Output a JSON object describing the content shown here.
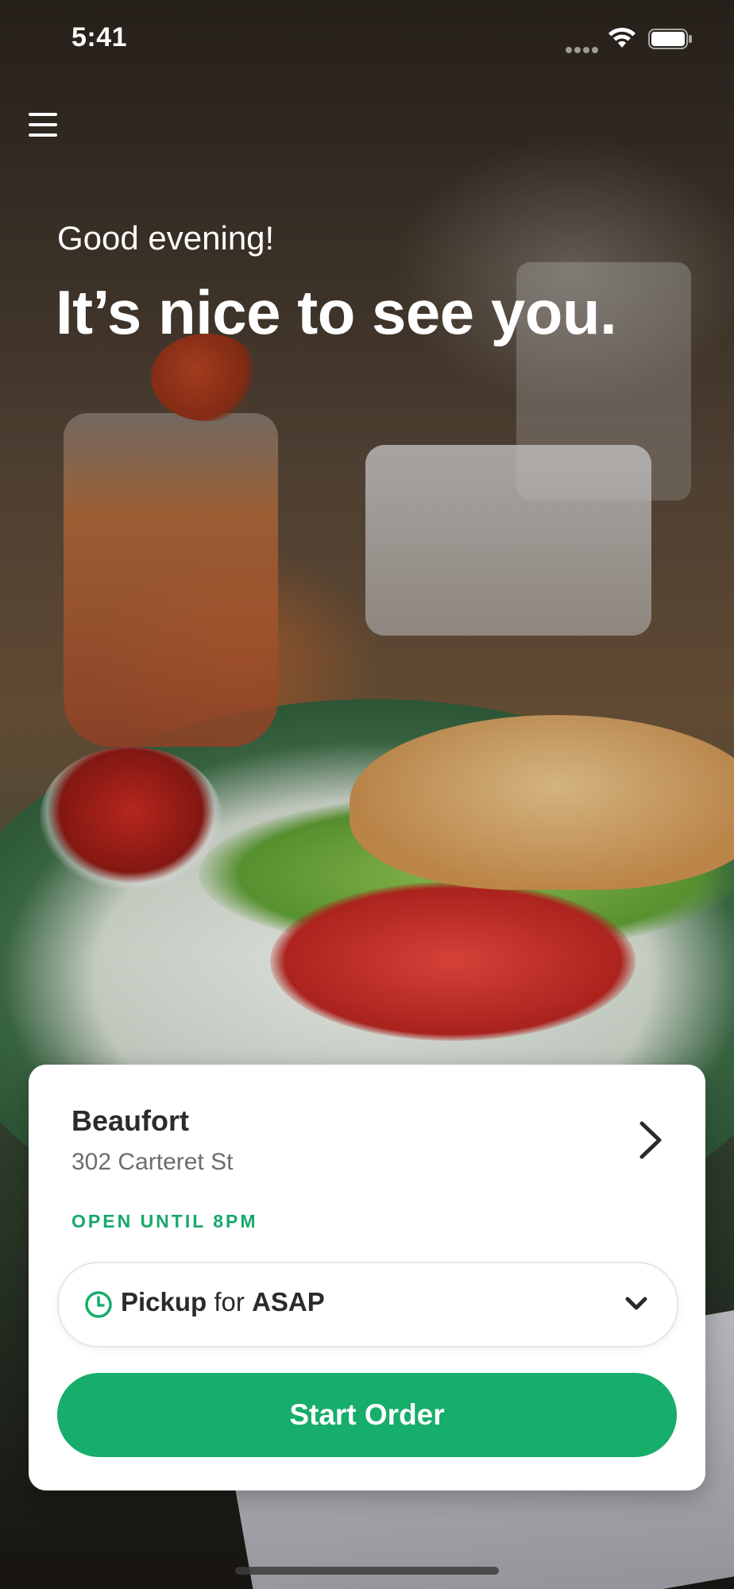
{
  "status_bar": {
    "time": "5:41"
  },
  "header": {
    "menu_icon": "hamburger-menu-icon"
  },
  "greeting": {
    "salutation": "Good evening!",
    "headline": "It’s nice to see you."
  },
  "location_card": {
    "name": "Beaufort",
    "address": "302 Carteret St",
    "open_status": "OPEN UNTIL 8PM",
    "order_mode": {
      "mode": "Pickup",
      "connector": "for",
      "time": "ASAP"
    },
    "start_button_label": "Start Order"
  },
  "colors": {
    "accent_green": "#17ad6b",
    "open_status_green": "#17a86a",
    "card_background": "#ffffff",
    "text_primary": "#2b2b2b",
    "text_secondary": "#6d6d6d"
  }
}
